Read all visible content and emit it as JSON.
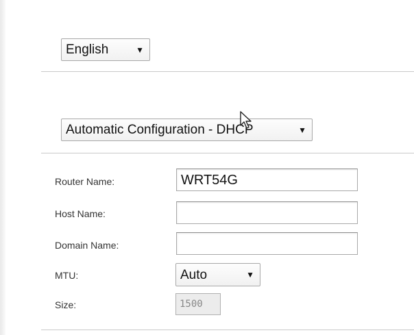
{
  "language": {
    "selected": "English"
  },
  "connection_type": {
    "selected": "Automatic Configuration - DHCP"
  },
  "settings": {
    "router_name": {
      "label": "Router Name:",
      "value": "WRT54G"
    },
    "host_name": {
      "label": "Host Name:",
      "value": ""
    },
    "domain_name": {
      "label": "Domain Name:",
      "value": ""
    },
    "mtu": {
      "label": "MTU:",
      "selected": "Auto"
    },
    "size": {
      "label": "Size:",
      "value": "1500"
    }
  },
  "icons": {
    "dropdown_arrow": "▼",
    "pointer": "mouse-pointer-icon"
  }
}
